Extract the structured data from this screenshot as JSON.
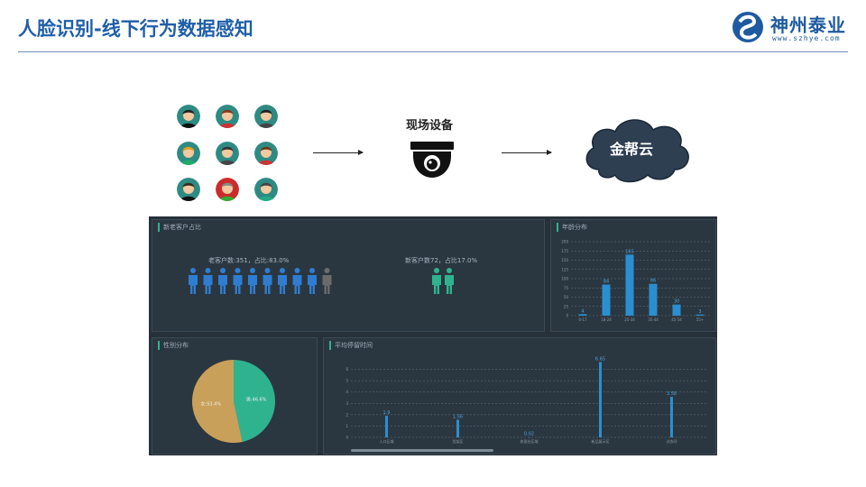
{
  "header": {
    "title": "人脸识别-线下行为数据感知",
    "logo_text": "神州泰业",
    "logo_url": "www.szhye.com"
  },
  "flow": {
    "device_label": "现场设备",
    "cloud_label": "金帮云"
  },
  "dashboard": {
    "customer_panel": {
      "title": "新老客户占比",
      "old_text": "老客户数:351，占比:83.0%",
      "new_text": "新客户数72，占比17.0%",
      "old_icons": 9,
      "new_icons": 2,
      "colors": {
        "old": "#2f7dd1",
        "new": "#2fb38f",
        "gray": "#6b6b6b"
      }
    },
    "gender_panel": {
      "title": "性别分布",
      "slices": [
        {
          "label": "男:46.6%",
          "value": 46.6,
          "color": "#2fb38f"
        },
        {
          "label": "女:53.4%",
          "value": 53.4,
          "color": "#c9a05a"
        }
      ]
    }
  },
  "chart_data": [
    {
      "type": "bar",
      "title": "年龄分布",
      "categories": [
        "0-17",
        "18-24",
        "25-34",
        "35-44",
        "45-54",
        "55+"
      ],
      "values": [
        4,
        84,
        165,
        86,
        30,
        3
      ],
      "ylim": [
        0,
        200
      ],
      "yticks": [
        0,
        25,
        50,
        75,
        100,
        125,
        150,
        175,
        200
      ],
      "color": "#2a8fd0"
    },
    {
      "type": "bar",
      "title": "平均停留时间",
      "categories": [
        "入口区域",
        "货架区",
        "收银台区域",
        "新品展示区",
        "试衣间"
      ],
      "values": [
        1.9,
        1.56,
        0.02,
        6.65,
        3.58
      ],
      "ylim": [
        0,
        7
      ],
      "yticks": [
        0,
        1,
        2,
        3,
        4,
        5,
        6
      ],
      "color": "#2a8fd0"
    }
  ]
}
